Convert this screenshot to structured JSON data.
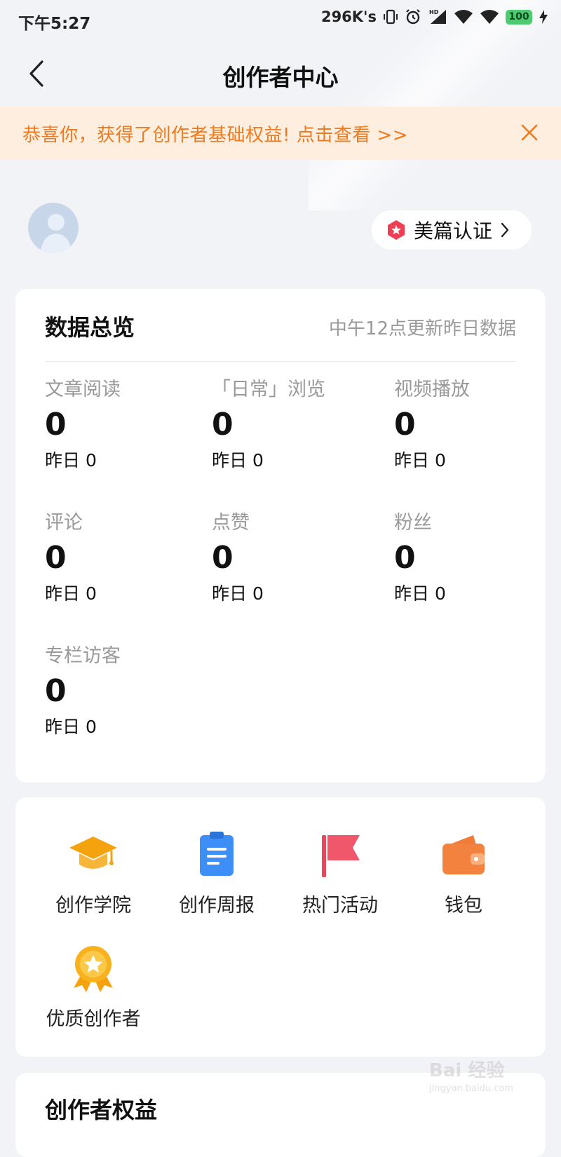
{
  "status_bar": {
    "time": "下午5:27",
    "net_speed": "296K's",
    "battery": "100",
    "icons": [
      "vibrate-icon",
      "alarm-icon",
      "hd-signal-icon",
      "wifi-icon",
      "wifi-icon-2",
      "battery-icon",
      "charging-icon"
    ]
  },
  "header": {
    "title": "创作者中心",
    "back_icon": "chevron-left-icon"
  },
  "notice": {
    "text": "恭喜你，获得了创作者基础权益! 点击查看 >>",
    "color": "#f07a1e",
    "close_icon": "close-icon"
  },
  "profile": {
    "avatar_icon": "default-avatar-icon",
    "certification_label": "美篇认证",
    "certification_icon": "red-badge-icon"
  },
  "overview": {
    "title": "数据总览",
    "update_note": "中午12点更新昨日数据",
    "stats": [
      {
        "label": "文章阅读",
        "value": "0",
        "yesterday": "昨日 0"
      },
      {
        "label": "「日常」浏览",
        "value": "0",
        "yesterday": "昨日 0"
      },
      {
        "label": "视频播放",
        "value": "0",
        "yesterday": "昨日 0"
      },
      {
        "label": "评论",
        "value": "0",
        "yesterday": "昨日 0"
      },
      {
        "label": "点赞",
        "value": "0",
        "yesterday": "昨日 0"
      },
      {
        "label": "粉丝",
        "value": "0",
        "yesterday": "昨日 0"
      },
      {
        "label": "专栏访客",
        "value": "0",
        "yesterday": "昨日 0"
      }
    ]
  },
  "tools": [
    {
      "label": "创作学院",
      "icon": "graduation-cap-icon"
    },
    {
      "label": "创作周报",
      "icon": "clipboard-report-icon"
    },
    {
      "label": "热门活动",
      "icon": "flag-icon"
    },
    {
      "label": "钱包",
      "icon": "wallet-icon"
    },
    {
      "label": "优质创作者",
      "icon": "star-medal-icon"
    }
  ],
  "rights": {
    "title": "创作者权益"
  },
  "watermark": {
    "main": "Bai 经验",
    "sub": "jingyan.baidu.com"
  }
}
